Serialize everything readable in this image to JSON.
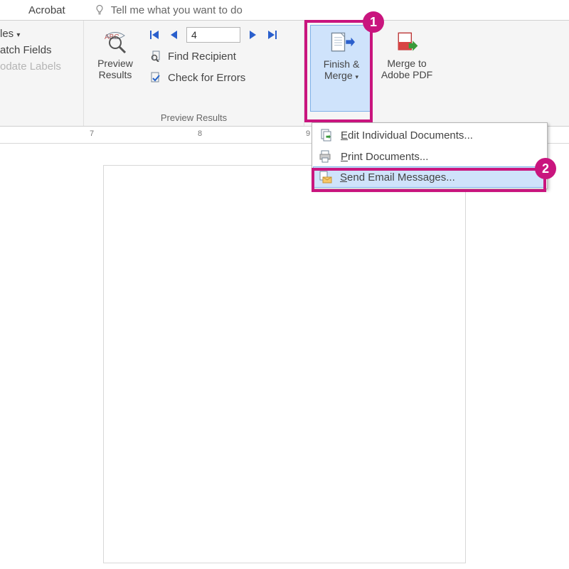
{
  "tabs": {
    "acrobat": "Acrobat",
    "tell_me": "Tell me what you want to do"
  },
  "left_group": {
    "rules": "les",
    "match_fields": "atch Fields",
    "update_labels": "odate Labels"
  },
  "preview_group": {
    "label": "Preview Results",
    "preview_results_line1": "Preview",
    "preview_results_line2": "Results",
    "record_number": "4",
    "find_recipient": "Find Recipient",
    "check_errors": "Check for Errors"
  },
  "finish_group": {
    "finish_merge_line1": "Finish &",
    "finish_merge_line2": "Merge",
    "merge_pdf_line1": "Merge to",
    "merge_pdf_line2": "Adobe PDF"
  },
  "dropdown": {
    "edit": "Edit Individual Documents...",
    "print": "Print Documents...",
    "send": "Send Email Messages..."
  },
  "ruler": {
    "n7": "7",
    "n8": "8",
    "n9": "9"
  },
  "callouts": {
    "c1": "1",
    "c2": "2"
  }
}
